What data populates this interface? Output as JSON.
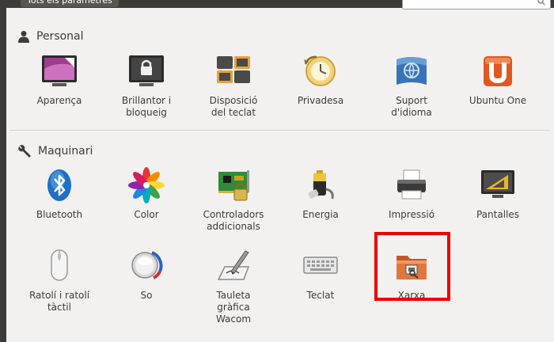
{
  "toolbar": {
    "all_settings_label": "Tots els paràmetres",
    "search_value": ""
  },
  "sections": [
    {
      "title": "Personal",
      "icon": "person-icon",
      "items": [
        {
          "label": "Aparença",
          "icon": "appearance-icon"
        },
        {
          "label": "Brillantor i\nbloqueig",
          "icon": "brightness-lock-icon"
        },
        {
          "label": "Disposició\ndel teclat",
          "icon": "keyboard-layout-icon"
        },
        {
          "label": "Privadesa",
          "icon": "privacy-icon"
        },
        {
          "label": "Suport\nd'idioma",
          "icon": "language-support-icon"
        },
        {
          "label": "Ubuntu One",
          "icon": "ubuntu-one-icon"
        }
      ]
    },
    {
      "title": "Maquinari",
      "icon": "wrench-icon",
      "items": [
        {
          "label": "Bluetooth",
          "icon": "bluetooth-icon"
        },
        {
          "label": "Color",
          "icon": "color-icon"
        },
        {
          "label": "Controladors\naddicionals",
          "icon": "additional-drivers-icon"
        },
        {
          "label": "Energia",
          "icon": "power-icon"
        },
        {
          "label": "Impressió",
          "icon": "printer-icon"
        },
        {
          "label": "Pantalles",
          "icon": "displays-icon"
        },
        {
          "label": "Ratolí i ratolí\ntàctil",
          "icon": "mouse-touchpad-icon"
        },
        {
          "label": "So",
          "icon": "sound-icon"
        },
        {
          "label": "Tauleta\ngràfica\nWacom",
          "icon": "wacom-tablet-icon"
        },
        {
          "label": "Teclat",
          "icon": "keyboard-icon"
        },
        {
          "label": "Xarxa",
          "icon": "network-icon"
        }
      ]
    }
  ],
  "colors": {
    "highlight": "#ee0000",
    "background": "#f2f1f0",
    "toolbar": "#3c3b37"
  }
}
